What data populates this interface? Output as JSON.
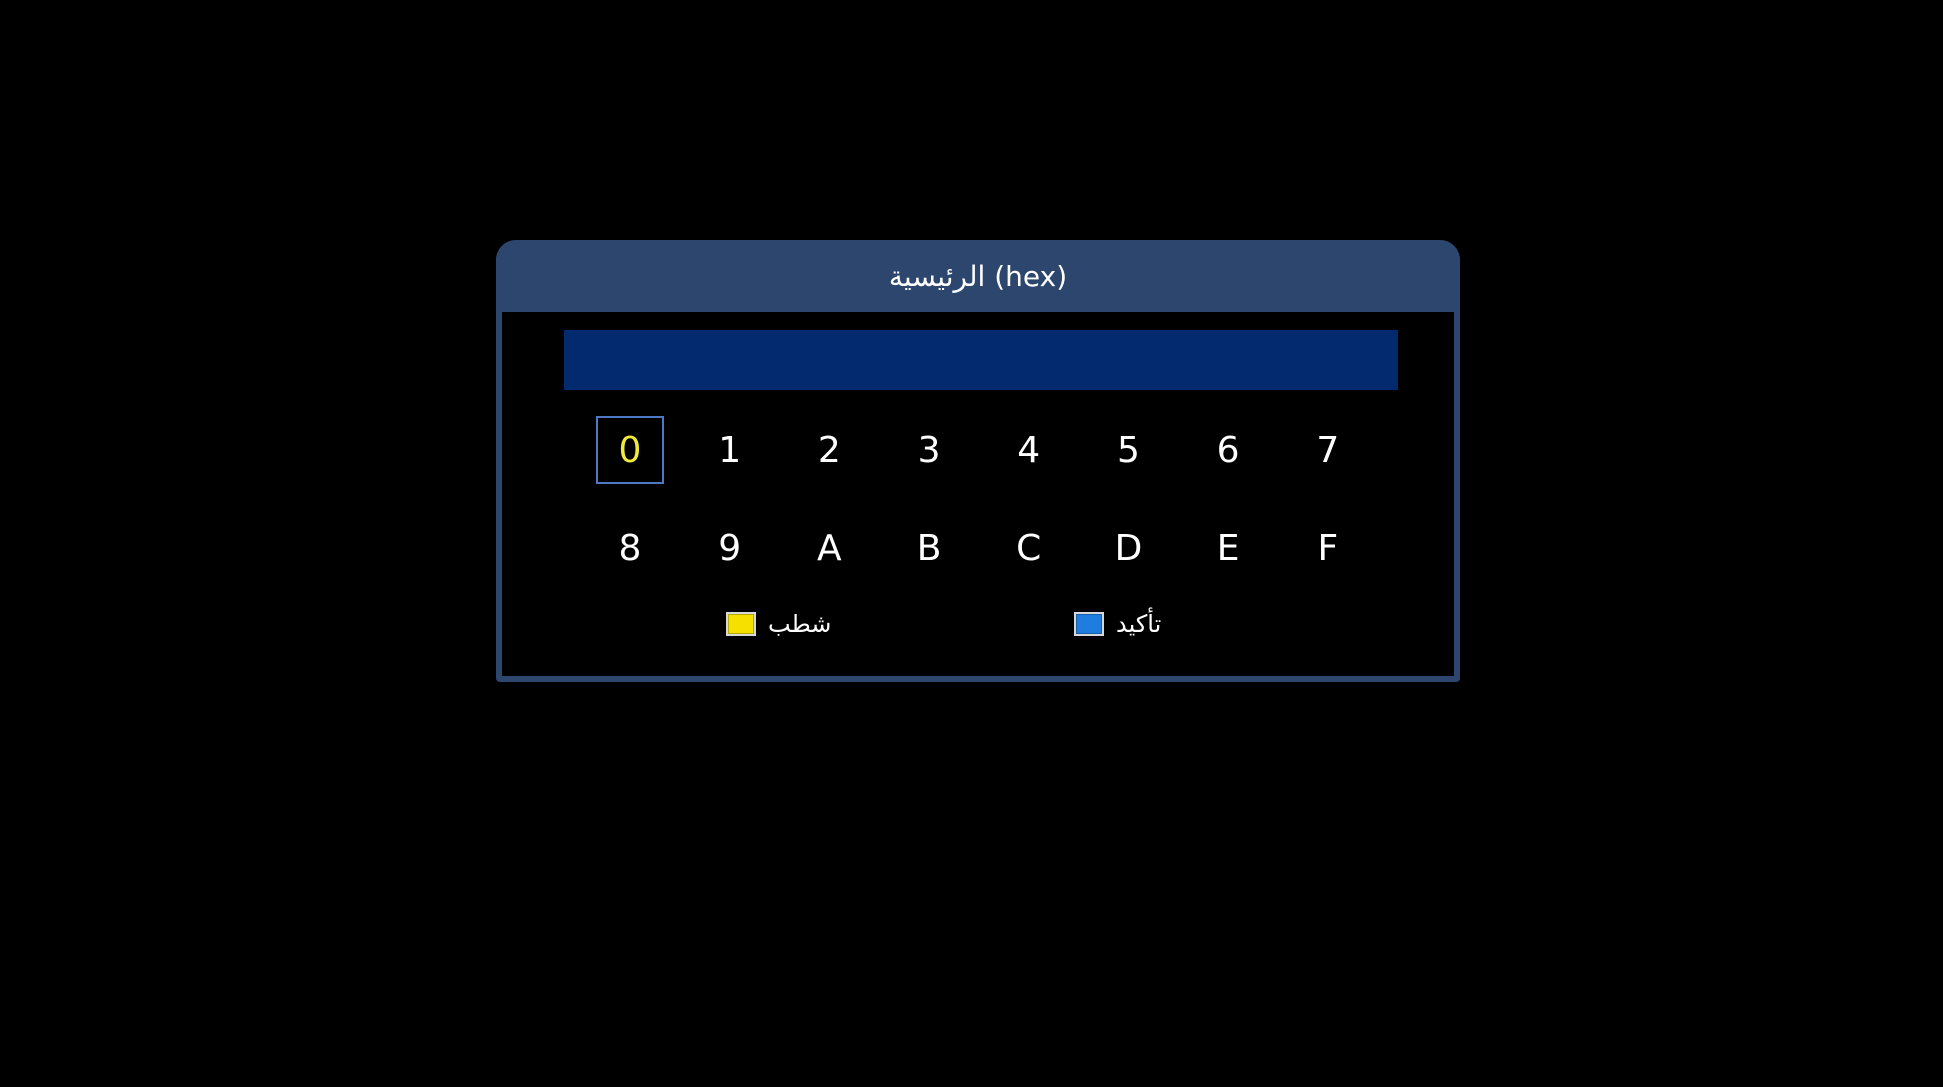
{
  "dialog": {
    "title": "الرئيسية (hex)",
    "input_value": "",
    "keys": [
      "0",
      "1",
      "2",
      "3",
      "4",
      "5",
      "6",
      "7",
      "8",
      "9",
      "A",
      "B",
      "C",
      "D",
      "E",
      "F"
    ],
    "selected_key": "0",
    "legend": {
      "delete_label": "شطب",
      "delete_color": "#f5e000",
      "confirm_label": "تأكيد",
      "confirm_color": "#1f7de0"
    }
  },
  "colors": {
    "background": "#000000",
    "frame": "#2c466d",
    "input_bar": "#032a6e",
    "selected_text": "#f0ea3c",
    "selected_border": "#4d78c4"
  }
}
